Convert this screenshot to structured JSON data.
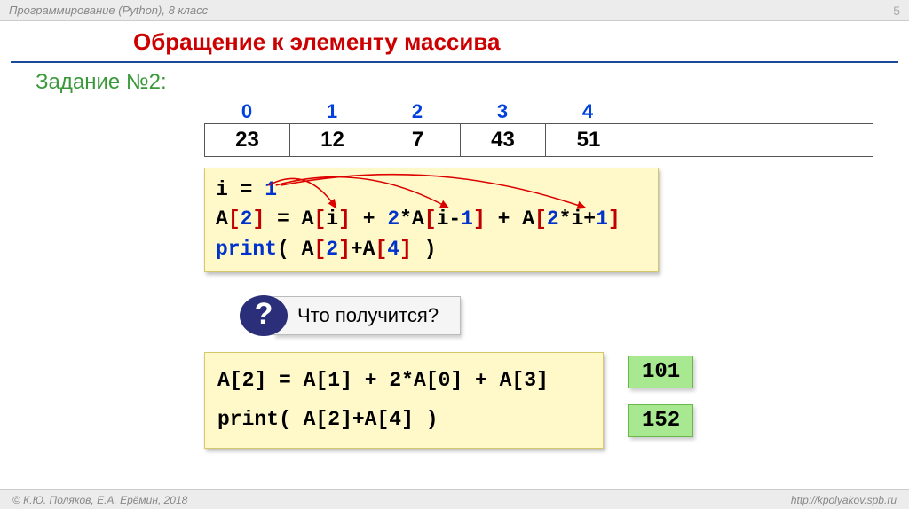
{
  "header": {
    "course": "Программирование (Python), 8 класс",
    "page": "5"
  },
  "title": "Обращение к элементу массива",
  "task_label": "Задание №2:",
  "array": {
    "indices": [
      "0",
      "1",
      "2",
      "3",
      "4"
    ],
    "values": [
      "23",
      "12",
      "7",
      "43",
      "51"
    ]
  },
  "code1": {
    "l1_a": "i = ",
    "l1_n": "1",
    "l2_a": "A",
    "l2_b": "[",
    "l2_c": "2",
    "l2_d": "]",
    "l2_e": " = A",
    "l2_f": "[",
    "l2_g": "i",
    "l2_h": "]",
    "l2_i": " + ",
    "l2_j": "2",
    "l2_k": "*A",
    "l2_l": "[",
    "l2_m": "i-",
    "l2_n": "1",
    "l2_o": "]",
    "l2_p": " + A",
    "l2_q": "[",
    "l2_r": "2",
    "l2_s": "*i+",
    "l2_t": "1",
    "l2_u": "]",
    "l3_a": "print",
    "l3_b": "( A",
    "l3_c": "[",
    "l3_d": "2",
    "l3_e": "]",
    "l3_f": "+A",
    "l3_g": "[",
    "l3_h": "4",
    "l3_i": "]",
    "l3_j": " )"
  },
  "question": {
    "mark": "?",
    "text": "Что получится?"
  },
  "code2": {
    "l1_a": "A",
    "l1_b": "[",
    "l1_c": "2",
    "l1_d": "]",
    "l1_e": " = A",
    "l1_f": "[",
    "l1_g": "1",
    "l1_h": "]",
    "l1_i": " + ",
    "l1_j": "2",
    "l1_k": "*A",
    "l1_l": "[",
    "l1_m": "0",
    "l1_n": "]",
    "l1_o": " + A",
    "l1_p": "[",
    "l1_q": "3",
    "l1_r": "]",
    "l2_a": "print",
    "l2_b": "( A",
    "l2_c": "[",
    "l2_d": "2",
    "l2_e": "]",
    "l2_f": "+A",
    "l2_g": "[",
    "l2_h": "4",
    "l2_i": "]",
    "l2_j": " )"
  },
  "answers": {
    "a1": "101",
    "a2": "152"
  },
  "footer": {
    "copyright": "© К.Ю. Поляков, Е.А. Ерёмин, 2018",
    "url": "http://kpolyakov.spb.ru"
  }
}
